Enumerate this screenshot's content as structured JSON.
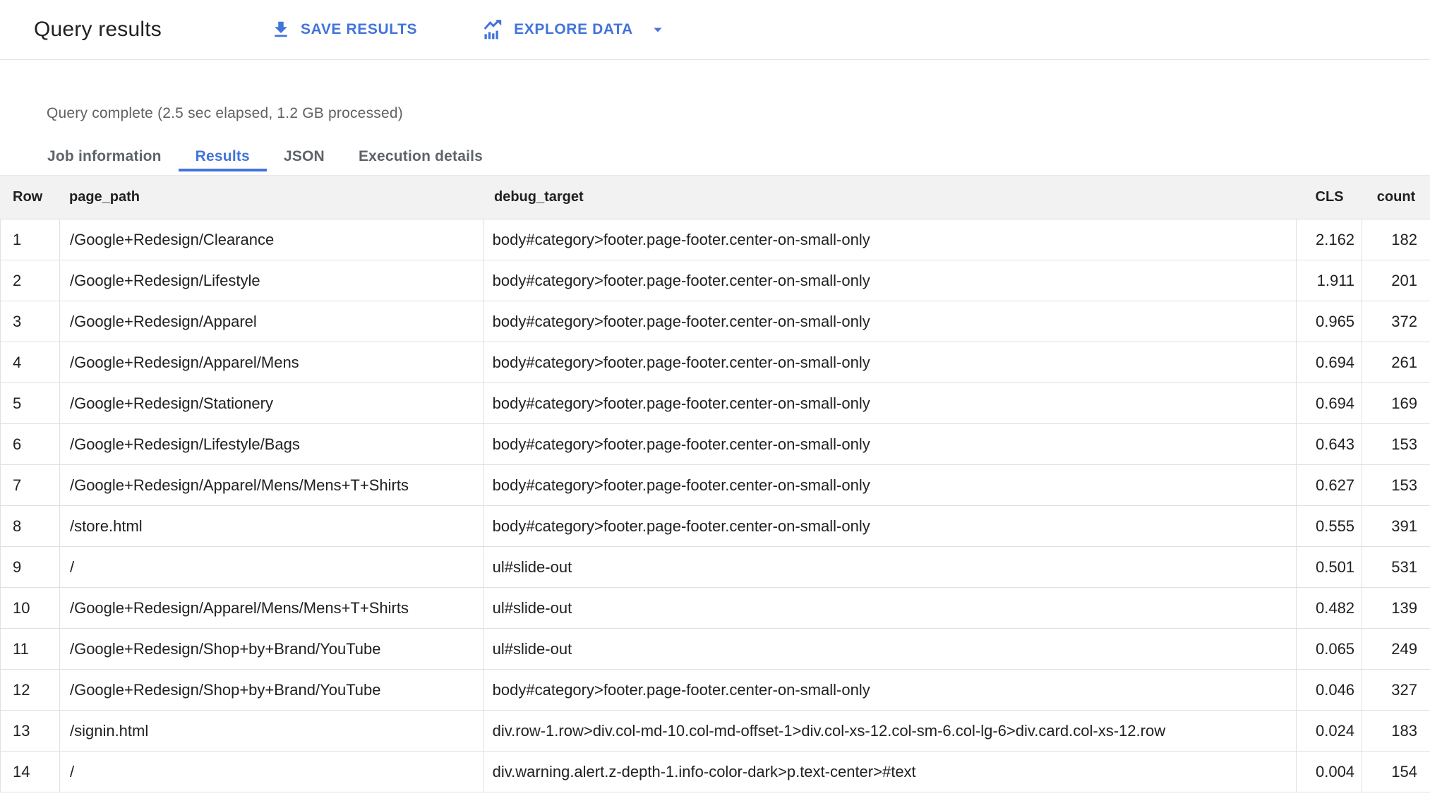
{
  "header": {
    "title": "Query results",
    "save_button_label": "SAVE RESULTS",
    "explore_button_label": "EXPLORE DATA",
    "icons": [
      "download-icon",
      "explore-chart-icon",
      "caret-down-icon"
    ]
  },
  "status_text": "Query complete (2.5 sec elapsed, 1.2 GB processed)",
  "tabs": [
    {
      "label": "Job information",
      "active": false
    },
    {
      "label": "Results",
      "active": true
    },
    {
      "label": "JSON",
      "active": false
    },
    {
      "label": "Execution details",
      "active": false
    }
  ],
  "table": {
    "columns": [
      "Row",
      "page_path",
      "debug_target",
      "CLS",
      "count"
    ],
    "rows": [
      {
        "row": "1",
        "page_path": "/Google+Redesign/Clearance",
        "debug_target": "body#category>footer.page-footer.center-on-small-only",
        "cls": "2.162",
        "count": "182"
      },
      {
        "row": "2",
        "page_path": "/Google+Redesign/Lifestyle",
        "debug_target": "body#category>footer.page-footer.center-on-small-only",
        "cls": "1.911",
        "count": "201"
      },
      {
        "row": "3",
        "page_path": "/Google+Redesign/Apparel",
        "debug_target": "body#category>footer.page-footer.center-on-small-only",
        "cls": "0.965",
        "count": "372"
      },
      {
        "row": "4",
        "page_path": "/Google+Redesign/Apparel/Mens",
        "debug_target": "body#category>footer.page-footer.center-on-small-only",
        "cls": "0.694",
        "count": "261"
      },
      {
        "row": "5",
        "page_path": "/Google+Redesign/Stationery",
        "debug_target": "body#category>footer.page-footer.center-on-small-only",
        "cls": "0.694",
        "count": "169"
      },
      {
        "row": "6",
        "page_path": "/Google+Redesign/Lifestyle/Bags",
        "debug_target": "body#category>footer.page-footer.center-on-small-only",
        "cls": "0.643",
        "count": "153"
      },
      {
        "row": "7",
        "page_path": "/Google+Redesign/Apparel/Mens/Mens+T+Shirts",
        "debug_target": "body#category>footer.page-footer.center-on-small-only",
        "cls": "0.627",
        "count": "153"
      },
      {
        "row": "8",
        "page_path": "/store.html",
        "debug_target": "body#category>footer.page-footer.center-on-small-only",
        "cls": "0.555",
        "count": "391"
      },
      {
        "row": "9",
        "page_path": "/",
        "debug_target": "ul#slide-out",
        "cls": "0.501",
        "count": "531"
      },
      {
        "row": "10",
        "page_path": "/Google+Redesign/Apparel/Mens/Mens+T+Shirts",
        "debug_target": "ul#slide-out",
        "cls": "0.482",
        "count": "139"
      },
      {
        "row": "11",
        "page_path": "/Google+Redesign/Shop+by+Brand/YouTube",
        "debug_target": "ul#slide-out",
        "cls": "0.065",
        "count": "249"
      },
      {
        "row": "12",
        "page_path": "/Google+Redesign/Shop+by+Brand/YouTube",
        "debug_target": "body#category>footer.page-footer.center-on-small-only",
        "cls": "0.046",
        "count": "327"
      },
      {
        "row": "13",
        "page_path": "/signin.html",
        "debug_target": "div.row-1.row>div.col-md-10.col-md-offset-1>div.col-xs-12.col-sm-6.col-lg-6>div.card.col-xs-12.row",
        "cls": "0.024",
        "count": "183"
      },
      {
        "row": "14",
        "page_path": "/",
        "debug_target": "div.warning.alert.z-depth-1.info-color-dark>p.text-center>#text",
        "cls": "0.004",
        "count": "154"
      }
    ]
  },
  "colors": {
    "accent_blue": "#4274da",
    "header_background": "#f2f2f2",
    "border": "#e0e0e0",
    "status_gray": "#616161"
  }
}
